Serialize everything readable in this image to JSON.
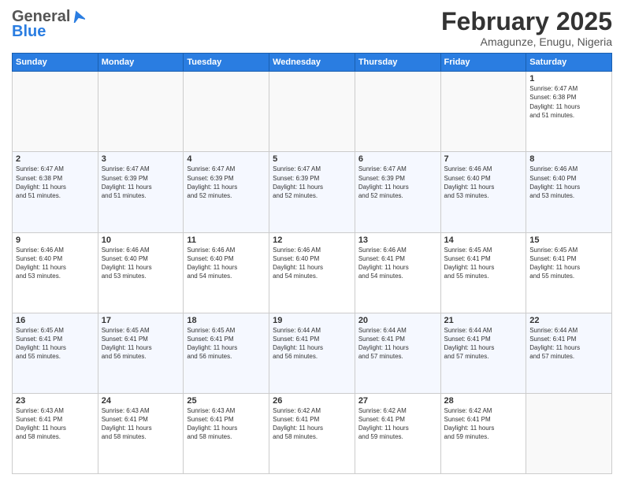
{
  "header": {
    "logo_general": "General",
    "logo_blue": "Blue",
    "month_title": "February 2025",
    "location": "Amagunze, Enugu, Nigeria"
  },
  "days_of_week": [
    "Sunday",
    "Monday",
    "Tuesday",
    "Wednesday",
    "Thursday",
    "Friday",
    "Saturday"
  ],
  "weeks": [
    {
      "cells": [
        {
          "day": "",
          "info": ""
        },
        {
          "day": "",
          "info": ""
        },
        {
          "day": "",
          "info": ""
        },
        {
          "day": "",
          "info": ""
        },
        {
          "day": "",
          "info": ""
        },
        {
          "day": "",
          "info": ""
        },
        {
          "day": "1",
          "info": "Sunrise: 6:47 AM\nSunset: 6:38 PM\nDaylight: 11 hours\nand 51 minutes."
        }
      ]
    },
    {
      "cells": [
        {
          "day": "2",
          "info": "Sunrise: 6:47 AM\nSunset: 6:38 PM\nDaylight: 11 hours\nand 51 minutes."
        },
        {
          "day": "3",
          "info": "Sunrise: 6:47 AM\nSunset: 6:39 PM\nDaylight: 11 hours\nand 51 minutes."
        },
        {
          "day": "4",
          "info": "Sunrise: 6:47 AM\nSunset: 6:39 PM\nDaylight: 11 hours\nand 52 minutes."
        },
        {
          "day": "5",
          "info": "Sunrise: 6:47 AM\nSunset: 6:39 PM\nDaylight: 11 hours\nand 52 minutes."
        },
        {
          "day": "6",
          "info": "Sunrise: 6:47 AM\nSunset: 6:39 PM\nDaylight: 11 hours\nand 52 minutes."
        },
        {
          "day": "7",
          "info": "Sunrise: 6:46 AM\nSunset: 6:40 PM\nDaylight: 11 hours\nand 53 minutes."
        },
        {
          "day": "8",
          "info": "Sunrise: 6:46 AM\nSunset: 6:40 PM\nDaylight: 11 hours\nand 53 minutes."
        }
      ]
    },
    {
      "cells": [
        {
          "day": "9",
          "info": "Sunrise: 6:46 AM\nSunset: 6:40 PM\nDaylight: 11 hours\nand 53 minutes."
        },
        {
          "day": "10",
          "info": "Sunrise: 6:46 AM\nSunset: 6:40 PM\nDaylight: 11 hours\nand 53 minutes."
        },
        {
          "day": "11",
          "info": "Sunrise: 6:46 AM\nSunset: 6:40 PM\nDaylight: 11 hours\nand 54 minutes."
        },
        {
          "day": "12",
          "info": "Sunrise: 6:46 AM\nSunset: 6:40 PM\nDaylight: 11 hours\nand 54 minutes."
        },
        {
          "day": "13",
          "info": "Sunrise: 6:46 AM\nSunset: 6:41 PM\nDaylight: 11 hours\nand 54 minutes."
        },
        {
          "day": "14",
          "info": "Sunrise: 6:45 AM\nSunset: 6:41 PM\nDaylight: 11 hours\nand 55 minutes."
        },
        {
          "day": "15",
          "info": "Sunrise: 6:45 AM\nSunset: 6:41 PM\nDaylight: 11 hours\nand 55 minutes."
        }
      ]
    },
    {
      "cells": [
        {
          "day": "16",
          "info": "Sunrise: 6:45 AM\nSunset: 6:41 PM\nDaylight: 11 hours\nand 55 minutes."
        },
        {
          "day": "17",
          "info": "Sunrise: 6:45 AM\nSunset: 6:41 PM\nDaylight: 11 hours\nand 56 minutes."
        },
        {
          "day": "18",
          "info": "Sunrise: 6:45 AM\nSunset: 6:41 PM\nDaylight: 11 hours\nand 56 minutes."
        },
        {
          "day": "19",
          "info": "Sunrise: 6:44 AM\nSunset: 6:41 PM\nDaylight: 11 hours\nand 56 minutes."
        },
        {
          "day": "20",
          "info": "Sunrise: 6:44 AM\nSunset: 6:41 PM\nDaylight: 11 hours\nand 57 minutes."
        },
        {
          "day": "21",
          "info": "Sunrise: 6:44 AM\nSunset: 6:41 PM\nDaylight: 11 hours\nand 57 minutes."
        },
        {
          "day": "22",
          "info": "Sunrise: 6:44 AM\nSunset: 6:41 PM\nDaylight: 11 hours\nand 57 minutes."
        }
      ]
    },
    {
      "cells": [
        {
          "day": "23",
          "info": "Sunrise: 6:43 AM\nSunset: 6:41 PM\nDaylight: 11 hours\nand 58 minutes."
        },
        {
          "day": "24",
          "info": "Sunrise: 6:43 AM\nSunset: 6:41 PM\nDaylight: 11 hours\nand 58 minutes."
        },
        {
          "day": "25",
          "info": "Sunrise: 6:43 AM\nSunset: 6:41 PM\nDaylight: 11 hours\nand 58 minutes."
        },
        {
          "day": "26",
          "info": "Sunrise: 6:42 AM\nSunset: 6:41 PM\nDaylight: 11 hours\nand 58 minutes."
        },
        {
          "day": "27",
          "info": "Sunrise: 6:42 AM\nSunset: 6:41 PM\nDaylight: 11 hours\nand 59 minutes."
        },
        {
          "day": "28",
          "info": "Sunrise: 6:42 AM\nSunset: 6:41 PM\nDaylight: 11 hours\nand 59 minutes."
        },
        {
          "day": "",
          "info": ""
        }
      ]
    }
  ]
}
